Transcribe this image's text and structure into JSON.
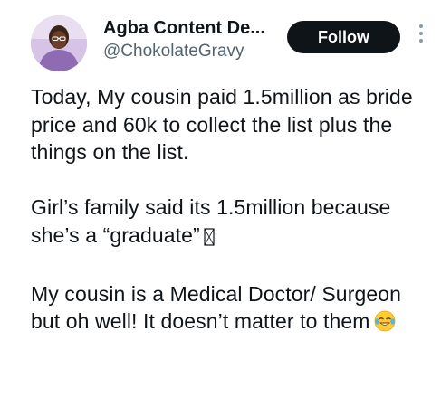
{
  "author": {
    "display_name": "Agba Content De...",
    "handle": "@ChokolateGravy"
  },
  "actions": {
    "follow_label": "Follow",
    "more_icon": "more-vertical-icon"
  },
  "tweet": {
    "paragraphs": [
      "Today, My cousin paid 1.5million as bride price and 60k to collect the list plus the things on the list.",
      "Girl’s family said its 1.5million because she’s a “graduate”",
      "My cousin is a Medical Doctor/ Surgeon but oh well! It doesn’t matter to them"
    ],
    "para2_trailing_glyph": "missing-glyph-box-icon",
    "para3_trailing_emoji": "face-with-tears-of-joy-icon"
  },
  "colors": {
    "text": "#0f1419",
    "secondary_text": "#536471",
    "follow_bg": "#0f1419",
    "follow_text": "#ffffff"
  }
}
